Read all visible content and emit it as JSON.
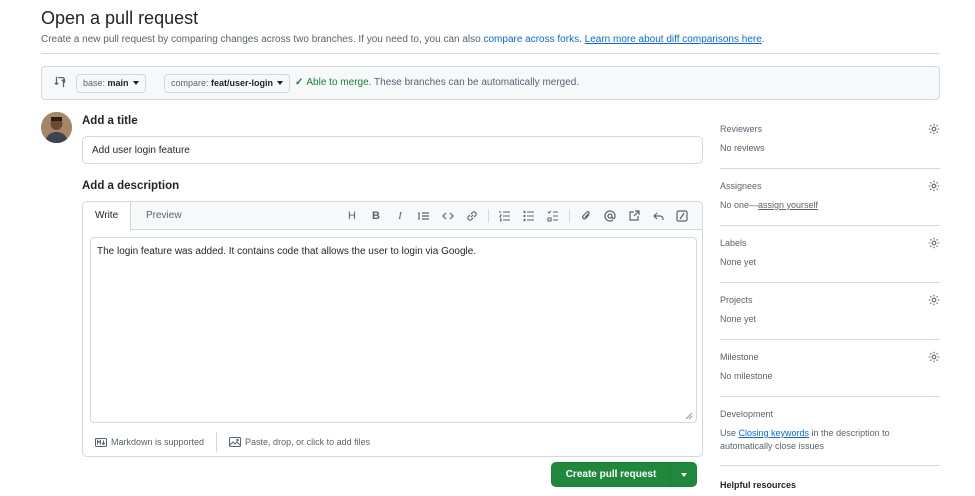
{
  "page": {
    "title": "Open a pull request",
    "subtitle_prefix": "Create a new pull request by comparing changes across two branches. If you need to, you can also ",
    "subtitle_link1": "compare across forks",
    "subtitle_mid": ". ",
    "subtitle_link2": "Learn more about diff comparisons here",
    "subtitle_suffix": "."
  },
  "compare": {
    "base_label": "base: ",
    "base_branch": "main",
    "compare_label": "compare: ",
    "compare_branch": "feat/user-login",
    "status_ok": "Able to merge.",
    "status_text": " These branches can be automatically merged."
  },
  "form": {
    "title_label": "Add a title",
    "title_value": "Add user login feature",
    "desc_label": "Add a description",
    "tab_write": "Write",
    "tab_preview": "Preview",
    "desc_value": "The login feature was added. It contains code that allows the user to login via Google.",
    "markdown_note": "Markdown is supported",
    "attach_note": "Paste, drop, or click to add files",
    "toolbar_heading": "H",
    "toolbar_bold": "B",
    "toolbar_italic": "I",
    "submit_label": "Create pull request"
  },
  "sidebar": {
    "reviewers": {
      "title": "Reviewers",
      "value": "No reviews"
    },
    "assignees": {
      "title": "Assignees",
      "value_prefix": "No one—",
      "value_link": "assign yourself"
    },
    "labels": {
      "title": "Labels",
      "value": "None yet"
    },
    "projects": {
      "title": "Projects",
      "value": "None yet"
    },
    "milestone": {
      "title": "Milestone",
      "value": "No milestone"
    },
    "development": {
      "title": "Development",
      "value_prefix": "Use ",
      "value_link": "Closing keywords",
      "value_suffix": " in the description to automatically close issues"
    },
    "helpful": "Helpful resources"
  },
  "colors": {
    "primary_button": "#1f883d",
    "link": "#0969da",
    "success": "#1a7f37",
    "border": "#d1d9e0"
  }
}
